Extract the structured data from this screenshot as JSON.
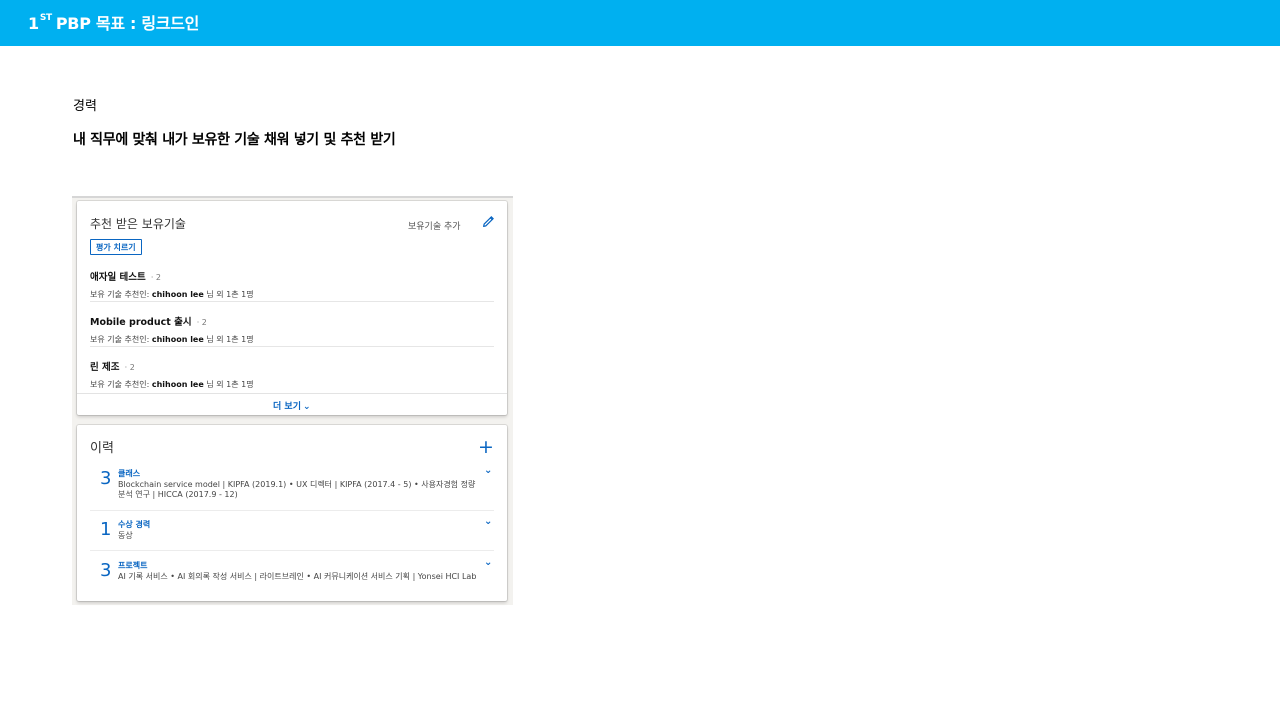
{
  "header": {
    "title_number": "1",
    "title_sup": "ST",
    "title_rest": "PBP 목표 : 링크드인"
  },
  "section_label": "경력",
  "headline": "내 직무에 맞춰 내가 보유한 기술 채워 넣기 및 추천 받기",
  "skills_card": {
    "title": "추천 받은 보유기술",
    "add_label": "보유기술 추가",
    "assess_label": "평가 치르기",
    "skills": [
      {
        "name": "애자일 테스트",
        "count": "· 2",
        "endorse_prefix": "보유 기술 추천인: ",
        "endorser": "chihoon lee",
        "endorse_suffix": " 님 외 1촌 1명"
      },
      {
        "name": "Mobile product 출시",
        "count": "· 2",
        "endorse_prefix": "보유 기술 추천인: ",
        "endorser": "chihoon lee",
        "endorse_suffix": " 님 외 1촌 1명"
      },
      {
        "name": "린 제조",
        "count": "· 2",
        "endorse_prefix": "보유 기술 추천인: ",
        "endorser": "chihoon lee",
        "endorse_suffix": " 님 외 1촌 1명"
      }
    ],
    "more_label": "더 보기",
    "more_chevron": "⌄"
  },
  "history_card": {
    "title": "이력",
    "add_symbol": "+",
    "items": [
      {
        "count": "3",
        "category": "클래스",
        "desc": "Blockchain service model | KIPFA (2019.1)  • UX 디렉터 | KIPFA (2017.4 - 5)  • 사용자경험 정량분석 연구 | HICCA (2017.9 - 12)"
      },
      {
        "count": "1",
        "category": "수상 경력",
        "desc": "동상"
      },
      {
        "count": "3",
        "category": "프로젝트",
        "desc": "AI 기록 서비스  • AI 회의록 작성 서비스 | 라이트브레인  • AI 커뮤니케이션 서비스 기획 | Yonsei HCI Lab"
      }
    ],
    "chevron": "⌄"
  },
  "colors": {
    "topbar": "#00b0f0",
    "linkedin_blue": "#0a66c2"
  }
}
